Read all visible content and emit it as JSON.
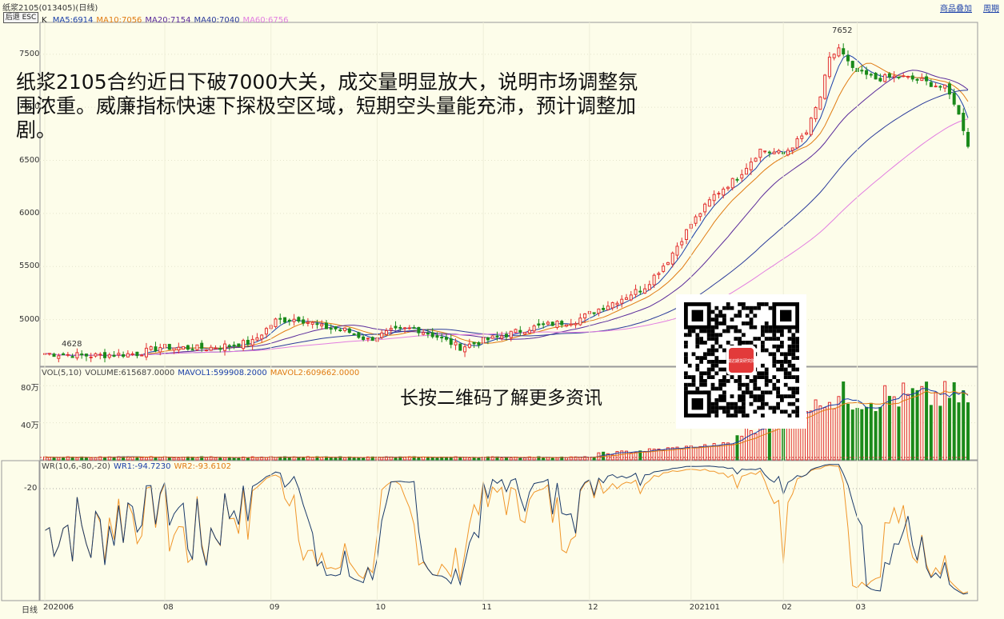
{
  "header": {
    "title": "纸浆2105(013405)(日线)",
    "link_overlay": "商品叠加",
    "link_period": "周期",
    "back_button": "后退 ESC"
  },
  "price_panel": {
    "indicator_prefix": "K",
    "ma_legend": [
      {
        "text": "MA5:6914",
        "color": "#1a3fa8"
      },
      {
        "text": "MA10:7056",
        "color": "#e07b12"
      },
      {
        "text": "MA20:7154",
        "color": "#5a2a9a"
      },
      {
        "text": "MA40:7040",
        "color": "#2a3a9a"
      },
      {
        "text": "MA60:6756",
        "color": "#e27ee0"
      }
    ],
    "high_label": "7652",
    "low_label": "4628",
    "y_ticks": [
      "7500",
      "7000",
      "6500",
      "6000",
      "5500",
      "5000"
    ],
    "overlay_text": "纸浆2105合约近日下破7000大关，成交量明显放大，说明市场调整氛围浓重。威廉指标快速下探极空区域，短期空头量能充沛，预计调整加剧。"
  },
  "volume_panel": {
    "legend": [
      {
        "text": "VOL(5,10)",
        "color": "#444444"
      },
      {
        "text": "VOLUME:615687.0000",
        "color": "#444444"
      },
      {
        "text": "MAVOL1:599908.2000",
        "color": "#1a3fa8"
      },
      {
        "text": "MAVOL2:609662.0000",
        "color": "#e07b12"
      }
    ],
    "y_ticks": [
      "80万",
      "40万"
    ]
  },
  "wr_panel": {
    "legend": [
      {
        "text": "WR(10,6,-80,-20)",
        "color": "#444444"
      },
      {
        "text": "WR1:-94.7230",
        "color": "#1a3fa8"
      },
      {
        "text": "WR2:-93.6102",
        "color": "#e07b12"
      }
    ],
    "y_ticks": [
      "-20"
    ]
  },
  "x_axis": {
    "label": "日线",
    "ticks": [
      "202006",
      "08",
      "09",
      "10",
      "11",
      "12",
      "202101",
      "02",
      "03"
    ]
  },
  "qr": {
    "caption": "长按二维码了解更多资讯",
    "logo_text": "瑞达期货研究院"
  },
  "colors": {
    "background": "#fdfdea",
    "up": "#e23030",
    "down": "#1a8a1a",
    "wr1": "#1a3a6a",
    "wr2": "#f0962a"
  },
  "chart_data": {
    "type": "candlestick",
    "x_ticks": [
      "202006",
      "08",
      "09",
      "10",
      "11",
      "12",
      "202101",
      "02",
      "03"
    ],
    "price_range": [
      4560,
      7800
    ],
    "price_ticks": [
      7500,
      7000,
      6500,
      6000,
      5500,
      5000
    ],
    "close_anchors": [
      [
        0,
        4680
      ],
      [
        10,
        4660
      ],
      [
        20,
        4680
      ],
      [
        25,
        4740
      ],
      [
        35,
        4730
      ],
      [
        45,
        4790
      ],
      [
        50,
        4990
      ],
      [
        55,
        5010
      ],
      [
        60,
        4930
      ],
      [
        65,
        4900
      ],
      [
        70,
        4810
      ],
      [
        75,
        4890
      ],
      [
        80,
        4920
      ],
      [
        85,
        4840
      ],
      [
        90,
        4740
      ],
      [
        95,
        4800
      ],
      [
        100,
        4860
      ],
      [
        105,
        4920
      ],
      [
        110,
        4960
      ],
      [
        115,
        4990
      ],
      [
        120,
        5100
      ],
      [
        125,
        5200
      ],
      [
        130,
        5310
      ],
      [
        135,
        5560
      ],
      [
        140,
        5900
      ],
      [
        145,
        6170
      ],
      [
        150,
        6340
      ],
      [
        155,
        6600
      ],
      [
        160,
        6560
      ],
      [
        165,
        6760
      ],
      [
        168,
        7100
      ],
      [
        170,
        7450
      ],
      [
        172,
        7560
      ],
      [
        175,
        7350
      ],
      [
        180,
        7270
      ],
      [
        185,
        7290
      ],
      [
        190,
        7250
      ],
      [
        195,
        7180
      ],
      [
        197,
        7050
      ],
      [
        199,
        6800
      ],
      [
        200,
        6650
      ]
    ],
    "bar_count": 201,
    "annotations": {
      "high": 7652,
      "low": 4628
    },
    "volume_y_ticks": [
      "80万",
      "40万"
    ],
    "volume_unit_max": 1000000,
    "volume_last": 615687,
    "mavol1_last": 599908.2,
    "mavol2_last": 609662.0,
    "ma_last": {
      "MA5": 6914,
      "MA10": 7056,
      "MA20": 7154,
      "MA40": 7040,
      "MA60": 6756
    },
    "wr_range": [
      0,
      -100
    ],
    "wr_last": {
      "WR1": -94.723,
      "WR2": -93.6102
    }
  }
}
